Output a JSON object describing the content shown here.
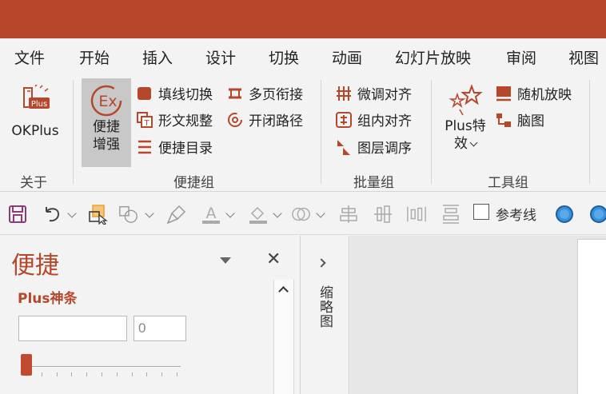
{
  "menu": {
    "tabs": [
      "文件",
      "开始",
      "插入",
      "设计",
      "切换",
      "动画",
      "幻灯片放映",
      "审阅",
      "视图"
    ]
  },
  "ribbon": {
    "groups": {
      "about": {
        "label": "关于",
        "okplus_label": "OKPlus",
        "okplus_icon_text": "Plus"
      },
      "convenience": {
        "label": "便捷组",
        "enhance_label_line1": "便捷",
        "enhance_label_line2": "增强",
        "enhance_icon_text": "Ex",
        "buttons": [
          "填线切换",
          "多页衔接",
          "形文规整",
          "开闭路径",
          "便捷目录"
        ]
      },
      "batch": {
        "label": "批量组",
        "buttons": [
          "微调对齐",
          "组内对齐",
          "图层调序"
        ]
      },
      "tools": {
        "label": "工具组",
        "effects_line1": "Plus特",
        "effects_line2": "效",
        "buttons": [
          "随机放映",
          "脑图"
        ]
      }
    }
  },
  "qat": {
    "reference_line_label": "参考线"
  },
  "pane": {
    "title": "便捷",
    "subtitle": "Plus神条",
    "input1_value": "",
    "input2_value": "0",
    "close_glyph": "✕",
    "slider_value": 0
  },
  "thumbnails": {
    "label": "缩略图"
  },
  "colors": {
    "accent": "#b7472a",
    "slider": "#c14b2e",
    "icon_orange": "#e8a030",
    "icon_blue": "#3a8fd9"
  }
}
